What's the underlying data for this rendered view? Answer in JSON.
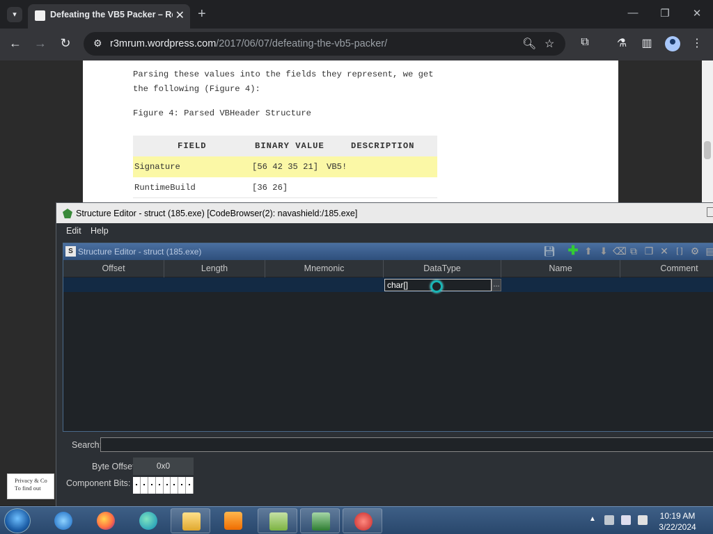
{
  "browser": {
    "tab_title": "Defeating the VB5 Packer – Re",
    "url_host": "r3mrum.wordpress.com",
    "url_path": "/2017/06/07/defeating-the-vb5-packer/"
  },
  "article": {
    "paragraph": "Parsing these values into the fields they represent, we get the following (Figure 4):",
    "caption": "Figure 4: Parsed VBHeader Structure",
    "table_headers": [
      "FIELD",
      "BINARY VALUE",
      "DESCRIPTION"
    ],
    "rows": [
      {
        "field": "Signature",
        "value": "[56 42 35 21]",
        "desc": "VB5!"
      },
      {
        "field": "RuntimeBuild",
        "value": "[36 26]",
        "desc": ""
      }
    ],
    "privacy_line1": "Privacy & Co",
    "privacy_line2": "To find out"
  },
  "ghidra": {
    "window_title": "Structure Editor - struct (185.exe) [CodeBrowser(2): navashield:/185.exe]",
    "menu": [
      "Edit",
      "Help"
    ],
    "pane_title": "Structure Editor - struct (185.exe)",
    "columns": [
      "Offset",
      "Length",
      "Mnemonic",
      "DataType",
      "Name",
      "Comment"
    ],
    "datatype_value": "char[]",
    "more_button": "...",
    "search_label": "Search:",
    "byte_offset_label": "Byte Offset:",
    "byte_offset_value": "0x0",
    "component_bits_label": "Component Bits:"
  },
  "taskbar": {
    "time": "10:19 AM",
    "date": "3/22/2024",
    "apps": [
      "internet-explorer",
      "firefox",
      "edge",
      "file-explorer",
      "media-player",
      "notepad-plus",
      "task-manager",
      "ghidra-app"
    ]
  }
}
